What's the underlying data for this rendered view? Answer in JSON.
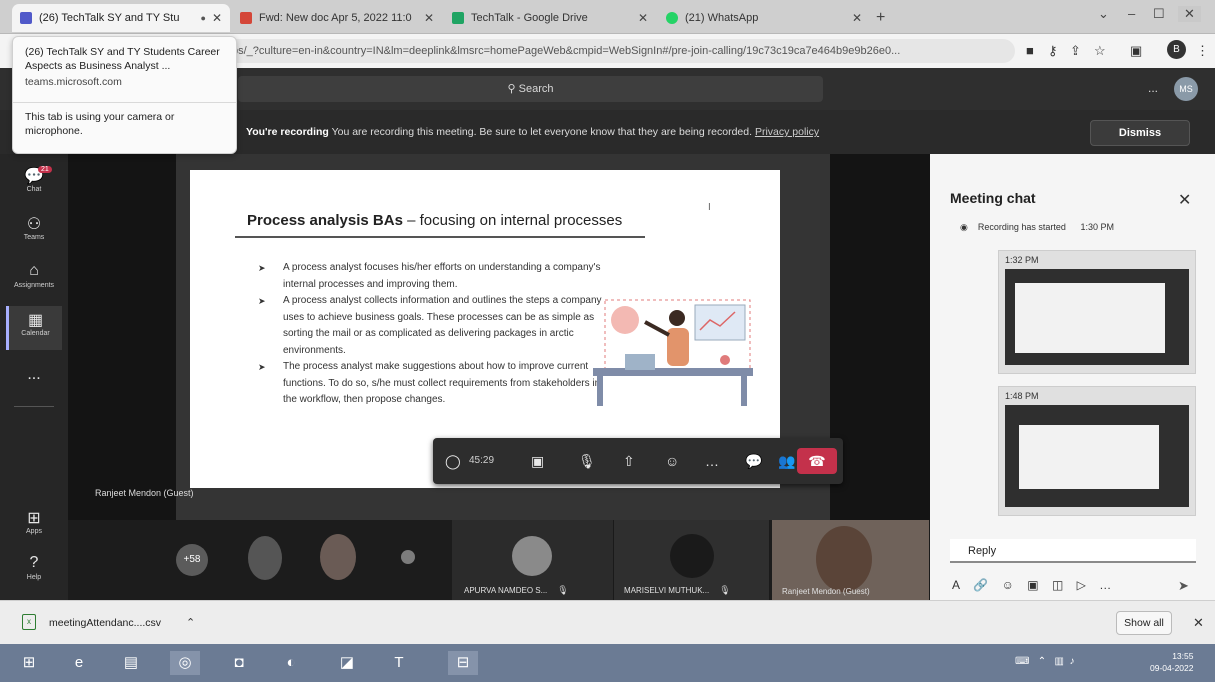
{
  "browser": {
    "tabs": [
      {
        "label": "(26) TechTalk SY and TY Stu",
        "active": true
      },
      {
        "label": "Fwd: New doc Apr 5, 2022 11:0"
      },
      {
        "label": "TechTalk - Google Drive"
      },
      {
        "label": "(21) WhatsApp"
      }
    ],
    "new_tab": "+",
    "url": "ps/_?culture=en-in&country=IN&lm=deeplink&lmsrc=homePageWeb&cmpid=WebSignIn#/pre-join-calling/19c73c19ca7e464b9e9b26e0...",
    "profile_initial": "B"
  },
  "hover_card": {
    "title": "(26) TechTalk SY and TY Students Career Aspects as Business Analyst ...",
    "domain": "teams.microsoft.com",
    "camera_note": "This tab is using your camera or microphone."
  },
  "teams": {
    "search_placeholder": "Search",
    "more": "...",
    "avatar_initials": "MS",
    "recording_bold": "You're recording",
    "recording_text": "You are recording this meeting. Be sure to let everyone know that they are being recorded.",
    "privacy_link": "Privacy policy",
    "dismiss": "Dismiss"
  },
  "rail": {
    "chat": "Chat",
    "chat_badge": "21",
    "teams": "Teams",
    "assignments": "Assignments",
    "calendar": "Calendar",
    "more": "...",
    "apps": "Apps",
    "help": "Help"
  },
  "slide": {
    "title_bold": "Process analysis BAs",
    "title_rest": " – focusing on internal processes",
    "cursor": "I",
    "bullets": [
      "A process analyst focuses his/her efforts on understanding a company's internal processes and improving them.",
      "A process analyst collects information and outlines the steps a company uses to achieve business goals. These processes can be as simple as sorting the mail or as complicated as delivering packages in arctic environments.",
      "The process analyst make suggestions about how to improve current functions. To do so, s/he must collect requirements from stakeholders in the workflow, then propose changes."
    ]
  },
  "controls": {
    "timer": "45:29"
  },
  "speaker_label": "Ranjeet Mendon (Guest)",
  "participants": {
    "overflow": "+58",
    "tile1_name": "APURVA NAMDEO S...",
    "tile2_name": "MARISELVI MUTHUK...",
    "tile3_name": "Ranjeet Mendon (Guest)"
  },
  "chat": {
    "title": "Meeting chat",
    "recording_msg": "Recording has started",
    "recording_time": "1:30 PM",
    "thumb1_time": "1:32 PM",
    "thumb2_time": "1:48 PM",
    "reply": "Reply"
  },
  "download": {
    "filename": "meetingAttendanc....csv",
    "show_all": "Show all"
  },
  "taskbar": {
    "time": "13:55",
    "date": "09-04-2022"
  }
}
